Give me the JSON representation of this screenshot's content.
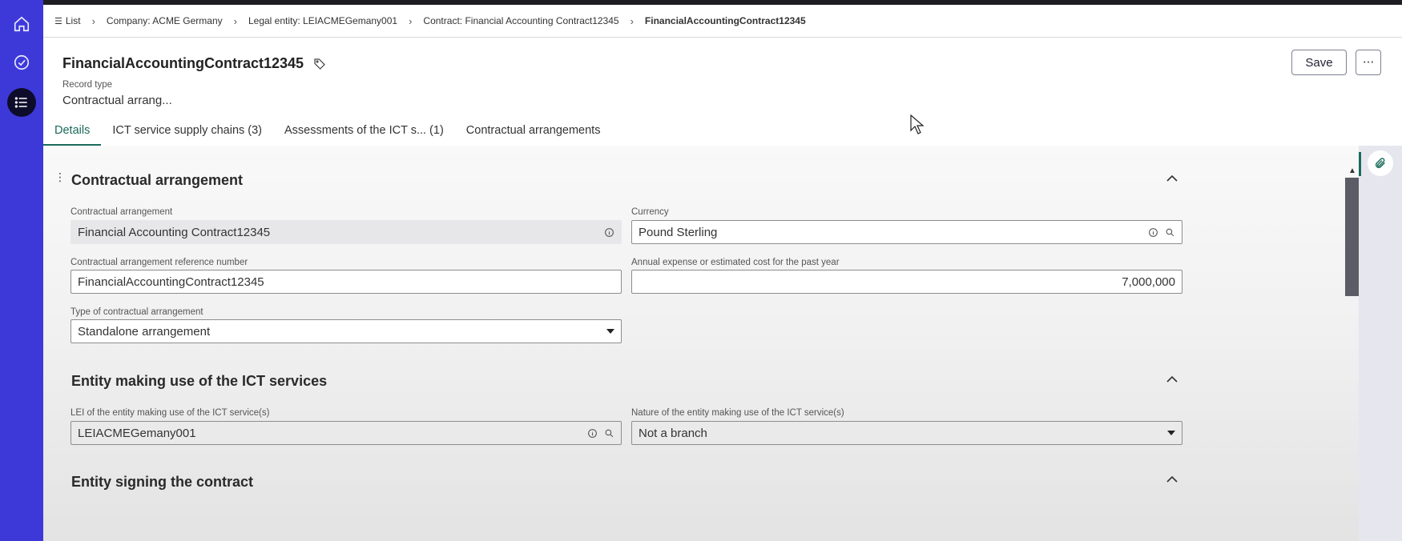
{
  "breadcrumbs": {
    "list": "List",
    "company": "Company: ACME Germany",
    "legal_entity": "Legal entity: LEIACMEGemany001",
    "contract": "Contract: Financial Accounting Contract12345",
    "current": "FinancialAccountingContract12345"
  },
  "record": {
    "title": "FinancialAccountingContract12345",
    "type_label": "Record type",
    "type_value": "Contractual arrang..."
  },
  "actions": {
    "save": "Save",
    "more": "···"
  },
  "tabs": [
    {
      "label": "Details"
    },
    {
      "label": "ICT service supply chains (3)"
    },
    {
      "label": "Assessments of the ICT s... (1)"
    },
    {
      "label": "Contractual arrangements"
    }
  ],
  "sections": {
    "contractual": {
      "title": "Contractual arrangement",
      "fields": {
        "arrangement_label": "Contractual arrangement",
        "arrangement_value": "Financial Accounting Contract12345",
        "currency_label": "Currency",
        "currency_value": "Pound Sterling",
        "ref_label": "Contractual arrangement reference number",
        "ref_value": "FinancialAccountingContract12345",
        "cost_label": "Annual expense or estimated cost for the past year",
        "cost_value": "7,000,000",
        "type_label": "Type of contractual arrangement",
        "type_value": "Standalone arrangement"
      }
    },
    "entity_use": {
      "title": "Entity making use of the ICT services",
      "fields": {
        "lei_label": "LEI of the entity making use of the ICT service(s)",
        "lei_value": "LEIACMEGemany001",
        "nature_label": "Nature of the entity making use of the ICT service(s)",
        "nature_value": "Not a branch"
      }
    },
    "entity_sign": {
      "title": "Entity signing the contract"
    }
  },
  "colors": {
    "nav": "#3d39d9",
    "accent": "#1a6a5a"
  }
}
